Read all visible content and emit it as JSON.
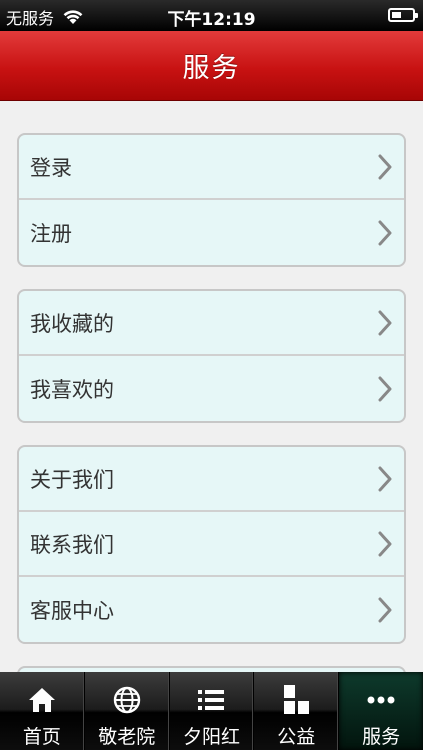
{
  "status_bar": {
    "carrier": "无服务",
    "time": "下午12:19"
  },
  "header": {
    "title": "服务"
  },
  "groups": [
    {
      "rows": [
        {
          "label": "登录"
        },
        {
          "label": "注册"
        }
      ]
    },
    {
      "rows": [
        {
          "label": "我收藏的"
        },
        {
          "label": "我喜欢的"
        }
      ]
    },
    {
      "rows": [
        {
          "label": "关于我们"
        },
        {
          "label": "联系我们"
        },
        {
          "label": "客服中心"
        }
      ]
    }
  ],
  "tab_bar": {
    "tabs": [
      {
        "label": "首页",
        "icon": "home-icon"
      },
      {
        "label": "敬老院",
        "icon": "globe-icon"
      },
      {
        "label": "夕阳红",
        "icon": "list-icon"
      },
      {
        "label": "公益",
        "icon": "blocks-icon"
      },
      {
        "label": "服务",
        "icon": "more-icon",
        "active": true
      }
    ]
  },
  "colors": {
    "header_red": "#c81212",
    "row_background": "#e6f7f7",
    "tab_active": "#0e3a2c"
  }
}
